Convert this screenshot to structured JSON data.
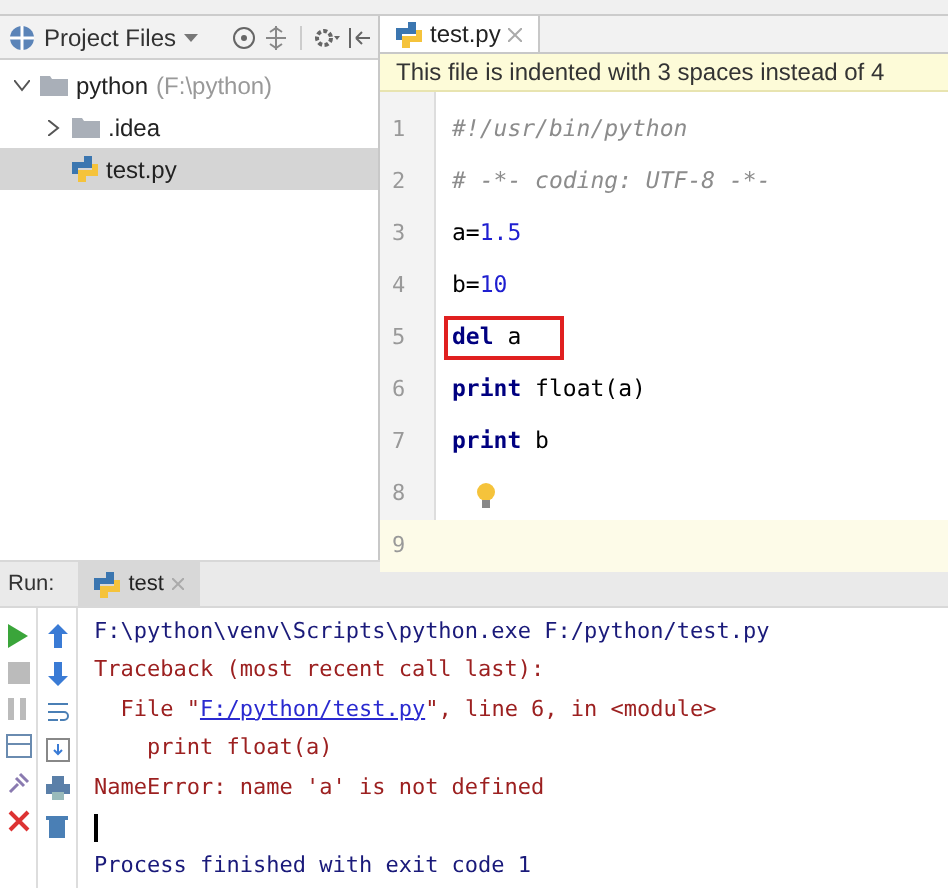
{
  "project_panel": {
    "title": "Project Files",
    "tree": [
      {
        "label": "python",
        "hint": "(F:\\python)",
        "kind": "folder",
        "expanded": true,
        "selected": false,
        "children": [
          {
            "label": ".idea",
            "kind": "folder",
            "expanded": false,
            "selected": false
          },
          {
            "label": "test.py",
            "kind": "python-file",
            "selected": true
          }
        ]
      }
    ]
  },
  "editor": {
    "tabs": [
      {
        "label": "test.py",
        "selected": true
      }
    ],
    "banner": "This file is indented with 3 spaces instead of 4",
    "lines": [
      {
        "number": "1",
        "tokens": [
          {
            "text": "#!/usr/bin/python",
            "kind": "comment"
          }
        ],
        "current": false,
        "boxed": false,
        "bulb": false
      },
      {
        "number": "2",
        "tokens": [
          {
            "text": "# -*- coding: UTF-8 -*-",
            "kind": "comment"
          }
        ],
        "current": false,
        "boxed": false,
        "bulb": false
      },
      {
        "number": "3",
        "tokens": [
          {
            "text": "a=",
            "kind": "plain"
          },
          {
            "text": "1.5",
            "kind": "number"
          }
        ],
        "current": false,
        "boxed": false,
        "bulb": false
      },
      {
        "number": "4",
        "tokens": [
          {
            "text": "b=",
            "kind": "plain"
          },
          {
            "text": "10",
            "kind": "number"
          }
        ],
        "current": false,
        "boxed": false,
        "bulb": false
      },
      {
        "number": "5",
        "tokens": [
          {
            "text": "del",
            "kind": "keyword"
          },
          {
            "text": " a",
            "kind": "plain"
          }
        ],
        "current": false,
        "boxed": true,
        "bulb": false
      },
      {
        "number": "6",
        "tokens": [
          {
            "text": "print",
            "kind": "keyword"
          },
          {
            "text": " float(a)",
            "kind": "plain"
          }
        ],
        "current": false,
        "boxed": false,
        "bulb": false
      },
      {
        "number": "7",
        "tokens": [
          {
            "text": "print",
            "kind": "keyword"
          },
          {
            "text": " b",
            "kind": "plain"
          }
        ],
        "current": false,
        "boxed": false,
        "bulb": false
      },
      {
        "number": "8",
        "current": false,
        "boxed": false,
        "bulb": true
      },
      {
        "number": "9",
        "current": true,
        "boxed": false,
        "bulb": false
      }
    ]
  },
  "run_panel": {
    "label": "Run:",
    "tabs": [
      {
        "label": "test",
        "selected": true
      }
    ],
    "console": [
      {
        "kind": "command",
        "segments": [
          {
            "text": "F:\\python\\venv\\Scripts\\python.exe F:/python/test.py",
            "kind": "plain"
          }
        ]
      },
      {
        "kind": "error",
        "segments": [
          {
            "text": "Traceback (most recent call last):",
            "kind": "plain"
          }
        ]
      },
      {
        "kind": "error",
        "segments": [
          {
            "text": "  File \"",
            "kind": "plain"
          },
          {
            "text": "F:/python/test.py",
            "kind": "link"
          },
          {
            "text": "\", line 6, in <module>",
            "kind": "plain"
          }
        ]
      },
      {
        "kind": "error",
        "segments": [
          {
            "text": "    print float(a)",
            "kind": "plain"
          }
        ]
      },
      {
        "kind": "error",
        "segments": [
          {
            "text": "NameError: name 'a' is not defined",
            "kind": "plain"
          }
        ]
      },
      {
        "kind": "cursor"
      },
      {
        "kind": "command",
        "segments": [
          {
            "text": "Process finished with exit code 1",
            "kind": "plain"
          }
        ]
      }
    ]
  }
}
